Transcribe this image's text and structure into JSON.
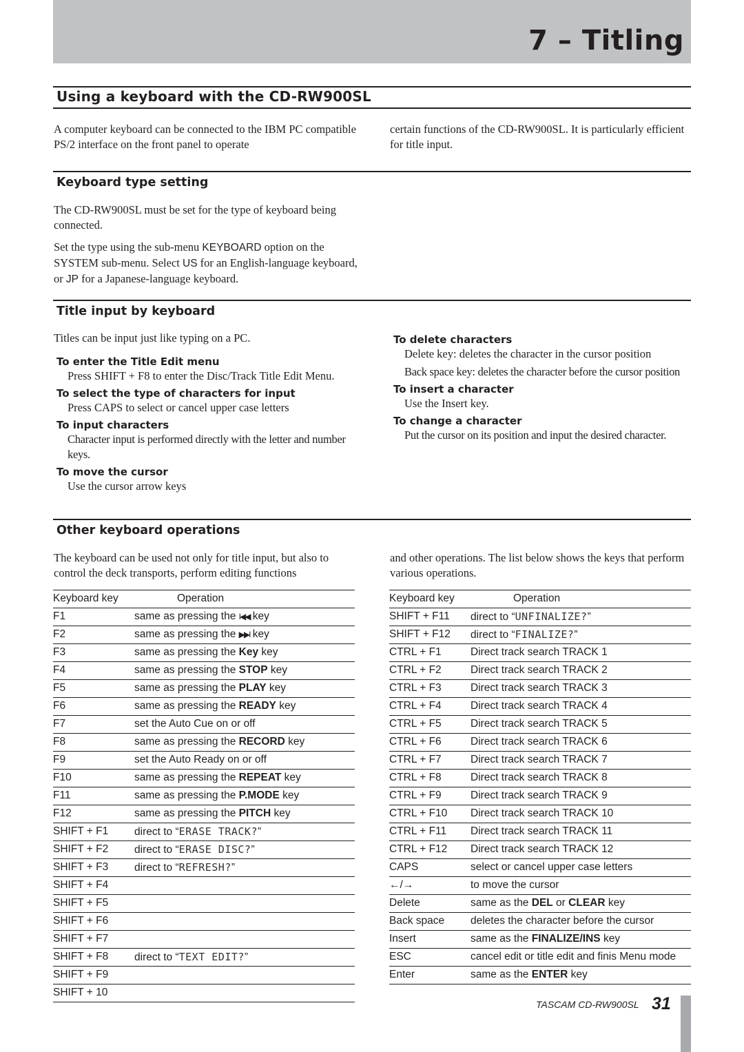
{
  "header": {
    "chapter_title": "7 – Titling"
  },
  "section_main": {
    "title": "Using a keyboard with the CD-RW900SL",
    "intro_left": "A computer keyboard can be connected to the IBM PC compatible PS/2 interface on the front panel to operate",
    "intro_right": "certain functions of the CD-RW900SL. It is particularly efficient for title input."
  },
  "keyboard_type": {
    "title": "Keyboard type setting",
    "para1": "The CD-RW900SL must be set for the type of keyboard being connected.",
    "para2_a": "Set the type using the sub-menu ",
    "para2_keyboard": "KEYBOARD",
    "para2_b": " option on the SYSTEM sub-menu. Select ",
    "para2_us": "US",
    "para2_c": " for an English-language keyboard, or ",
    "para2_jp": "JP",
    "para2_d": " for a Japanese-language keyboard."
  },
  "title_input": {
    "title": "Title input by keyboard",
    "intro": "Titles can be input just like typing on a PC.",
    "left_items": [
      {
        "heading": "To enter the Title Edit menu",
        "body": [
          "Press SHIFT + F8 to enter the Disc/Track Title Edit Menu."
        ]
      },
      {
        "heading": "To select the type of characters for input",
        "body": [
          "Press CAPS to select or cancel upper case letters"
        ]
      },
      {
        "heading": "To input characters",
        "body": [
          "Character input is performed directly with the letter and number keys."
        ]
      },
      {
        "heading": "To move the cursor",
        "body": [
          "Use the cursor arrow keys"
        ]
      }
    ],
    "right_items": [
      {
        "heading": "To delete characters",
        "body": [
          "Delete key: deletes the character in the cursor position",
          "Back space key: deletes the character before the cursor position"
        ]
      },
      {
        "heading": "To insert a character",
        "body": [
          "Use the Insert key."
        ]
      },
      {
        "heading": "To change a character",
        "body": [
          "Put the cursor on its position and input the desired character."
        ]
      }
    ]
  },
  "other_ops": {
    "title": "Other keyboard operations",
    "intro_left": "The keyboard can be used not only for title input, but also to control the deck transports, perform editing functions",
    "intro_right": "and other operations. The list below shows the keys that perform various operations.",
    "columns": {
      "key": "Keyboard key",
      "operation": "Operation"
    },
    "table_left": [
      {
        "key": "F1",
        "pre": "same as pressing the ",
        "bold": "",
        "icon": "skip-back-icon",
        "icon_glyph": "I◀◀",
        "post": " key",
        "lcd": ""
      },
      {
        "key": "F2",
        "pre": "same as pressing the ",
        "bold": "",
        "icon": "skip-forward-icon",
        "icon_glyph": "▶▶I",
        "post": " key",
        "lcd": ""
      },
      {
        "key": "F3",
        "pre": "same as pressing the ",
        "bold": "Key",
        "icon": "",
        "icon_glyph": "",
        "post": " key",
        "lcd": ""
      },
      {
        "key": "F4",
        "pre": "same as pressing the ",
        "bold": "STOP",
        "icon": "",
        "icon_glyph": "",
        "post": " key",
        "lcd": ""
      },
      {
        "key": "F5",
        "pre": "same as pressing the ",
        "bold": "PLAY",
        "icon": "",
        "icon_glyph": "",
        "post": " key",
        "lcd": ""
      },
      {
        "key": "F6",
        "pre": "same as pressing the ",
        "bold": "READY",
        "icon": "",
        "icon_glyph": "",
        "post": " key",
        "lcd": ""
      },
      {
        "key": "F7",
        "pre": "set the Auto Cue on or off",
        "bold": "",
        "icon": "",
        "icon_glyph": "",
        "post": "",
        "lcd": ""
      },
      {
        "key": "F8",
        "pre": "same as pressing the ",
        "bold": "RECORD",
        "icon": "",
        "icon_glyph": "",
        "post": " key",
        "lcd": ""
      },
      {
        "key": "F9",
        "pre": "set the Auto Ready on or off",
        "bold": "",
        "icon": "",
        "icon_glyph": "",
        "post": "",
        "lcd": ""
      },
      {
        "key": "F10",
        "pre": "same as pressing the ",
        "bold": "REPEAT",
        "icon": "",
        "icon_glyph": "",
        "post": " key",
        "lcd": ""
      },
      {
        "key": "F11",
        "pre": "same as pressing the ",
        "bold": "P.MODE",
        "icon": "",
        "icon_glyph": "",
        "post": " key",
        "lcd": ""
      },
      {
        "key": "F12",
        "pre": "same as pressing the ",
        "bold": "PITCH",
        "icon": "",
        "icon_glyph": "",
        "post": " key",
        "lcd": ""
      },
      {
        "key": "SHIFT + F1",
        "pre": "direct to “",
        "bold": "",
        "icon": "",
        "icon_glyph": "",
        "post": "”",
        "lcd": "ERASE TRACK?"
      },
      {
        "key": "SHIFT + F2",
        "pre": "direct to “",
        "bold": "",
        "icon": "",
        "icon_glyph": "",
        "post": "”",
        "lcd": "ERASE DISC?"
      },
      {
        "key": "SHIFT + F3",
        "pre": "direct to “",
        "bold": "",
        "icon": "",
        "icon_glyph": "",
        "post": "”",
        "lcd": "REFRESH?"
      },
      {
        "key": "SHIFT + F4",
        "pre": "",
        "bold": "",
        "icon": "",
        "icon_glyph": "",
        "post": "",
        "lcd": ""
      },
      {
        "key": "SHIFT + F5",
        "pre": "",
        "bold": "",
        "icon": "",
        "icon_glyph": "",
        "post": "",
        "lcd": ""
      },
      {
        "key": "SHIFT + F6",
        "pre": "",
        "bold": "",
        "icon": "",
        "icon_glyph": "",
        "post": "",
        "lcd": ""
      },
      {
        "key": "SHIFT + F7",
        "pre": "",
        "bold": "",
        "icon": "",
        "icon_glyph": "",
        "post": "",
        "lcd": ""
      },
      {
        "key": "SHIFT + F8",
        "pre": "direct to “",
        "bold": "",
        "icon": "",
        "icon_glyph": "",
        "post": "”",
        "lcd": "TEXT EDIT?"
      },
      {
        "key": "SHIFT + F9",
        "pre": "",
        "bold": "",
        "icon": "",
        "icon_glyph": "",
        "post": "",
        "lcd": ""
      },
      {
        "key": "SHIFT + 10",
        "pre": "",
        "bold": "",
        "icon": "",
        "icon_glyph": "",
        "post": "",
        "lcd": ""
      }
    ],
    "table_right": [
      {
        "key": "SHIFT + F11",
        "pre": "direct to “",
        "bold": "",
        "bold2": "",
        "mid": "",
        "post": "”",
        "lcd": "UNFINALIZE?"
      },
      {
        "key": "SHIFT + F12",
        "pre": "direct to “",
        "bold": "",
        "bold2": "",
        "mid": "",
        "post": "”",
        "lcd": "FINALIZE?"
      },
      {
        "key": "CTRL + F1",
        "pre": "Direct track search TRACK 1",
        "bold": "",
        "bold2": "",
        "mid": "",
        "post": "",
        "lcd": ""
      },
      {
        "key": "CTRL + F2",
        "pre": "Direct track search TRACK 2",
        "bold": "",
        "bold2": "",
        "mid": "",
        "post": "",
        "lcd": ""
      },
      {
        "key": "CTRL + F3",
        "pre": "Direct track search TRACK 3",
        "bold": "",
        "bold2": "",
        "mid": "",
        "post": "",
        "lcd": ""
      },
      {
        "key": "CTRL + F4",
        "pre": "Direct track search TRACK 4",
        "bold": "",
        "bold2": "",
        "mid": "",
        "post": "",
        "lcd": ""
      },
      {
        "key": "CTRL + F5",
        "pre": "Direct track search TRACK 5",
        "bold": "",
        "bold2": "",
        "mid": "",
        "post": "",
        "lcd": ""
      },
      {
        "key": "CTRL + F6",
        "pre": "Direct track search TRACK 6",
        "bold": "",
        "bold2": "",
        "mid": "",
        "post": "",
        "lcd": ""
      },
      {
        "key": "CTRL + F7",
        "pre": "Direct track search TRACK 7",
        "bold": "",
        "bold2": "",
        "mid": "",
        "post": "",
        "lcd": ""
      },
      {
        "key": "CTRL + F8",
        "pre": "Direct track search TRACK 8",
        "bold": "",
        "bold2": "",
        "mid": "",
        "post": "",
        "lcd": ""
      },
      {
        "key": "CTRL + F9",
        "pre": "Direct track search TRACK 9",
        "bold": "",
        "bold2": "",
        "mid": "",
        "post": "",
        "lcd": ""
      },
      {
        "key": "CTRL + F10",
        "pre": "Direct track search TRACK 10",
        "bold": "",
        "bold2": "",
        "mid": "",
        "post": "",
        "lcd": ""
      },
      {
        "key": "CTRL + F11",
        "pre": "Direct track search TRACK 11",
        "bold": "",
        "bold2": "",
        "mid": "",
        "post": "",
        "lcd": ""
      },
      {
        "key": "CTRL + F12",
        "pre": "Direct track search TRACK 12",
        "bold": "",
        "bold2": "",
        "mid": "",
        "post": "",
        "lcd": ""
      },
      {
        "key": "CAPS",
        "pre": "select or cancel upper case letters",
        "bold": "",
        "bold2": "",
        "mid": "",
        "post": "",
        "lcd": ""
      },
      {
        "key": "←/→",
        "pre": "to move the cursor",
        "bold": "",
        "bold2": "",
        "mid": "",
        "post": "",
        "lcd": ""
      },
      {
        "key": "Delete",
        "pre": "same as the ",
        "bold": "DEL",
        "mid": " or ",
        "bold2": "CLEAR",
        "post": " key",
        "lcd": ""
      },
      {
        "key": "Back space",
        "pre": "deletes the character before the cursor",
        "bold": "",
        "bold2": "",
        "mid": "",
        "post": "",
        "lcd": ""
      },
      {
        "key": "Insert",
        "pre": "same as the ",
        "bold": "FINALIZE/INS",
        "bold2": "",
        "mid": "",
        "post": " key",
        "lcd": ""
      },
      {
        "key": "ESC",
        "pre": "cancel edit or title edit and finis Menu mode",
        "bold": "",
        "bold2": "",
        "mid": "",
        "post": "",
        "lcd": ""
      },
      {
        "key": "Enter",
        "pre": "same as the ",
        "bold": "ENTER",
        "bold2": "",
        "mid": "",
        "post": " key",
        "lcd": ""
      }
    ]
  },
  "footer": {
    "brand_model": "TASCAM  CD-RW900SL",
    "page_number": "31"
  },
  "colors": {
    "chapter_band": "#c1c2c4",
    "text": "#231f20",
    "edge_tab": "#a8a9ad"
  }
}
